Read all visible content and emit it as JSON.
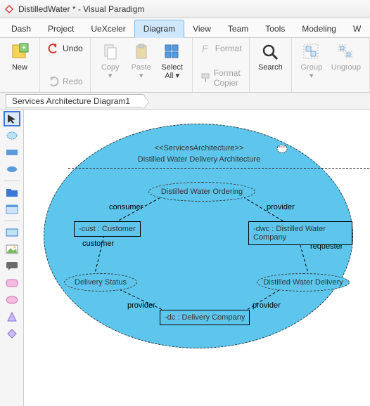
{
  "window": {
    "title": "DistilledWater * - Visual Paradigm"
  },
  "menu": {
    "items": [
      "Dash",
      "Project",
      "UeXceler",
      "Diagram",
      "View",
      "Team",
      "Tools",
      "Modeling",
      "W"
    ],
    "active_index": 3
  },
  "ribbon": {
    "new": "New",
    "undo": "Undo",
    "redo": "Redo",
    "copy": "Copy",
    "paste": "Paste",
    "select_all": "Select\nAll",
    "format": "Format",
    "format_copier": "Format Copier",
    "search": "Search",
    "group": "Group",
    "ungroup": "Ungroup"
  },
  "breadcrumb": {
    "current": "Services Architecture Diagram1"
  },
  "diagram": {
    "stereotype": "<<ServicesArchitecture>>",
    "title": "Distilled Water Delivery Architecture",
    "contracts": {
      "ordering": "Distilled Water Ordering",
      "status": "Delivery Status",
      "delivery": "Distilled Water Delivery"
    },
    "participants": {
      "customer": "-cust : Customer",
      "dwc": "-dwc : Distilled Water Company",
      "dc": "-dc : Delivery Company"
    },
    "roles": {
      "consumer": "consumer",
      "provider": "provider",
      "customer": "customer",
      "requester": "requester"
    }
  }
}
